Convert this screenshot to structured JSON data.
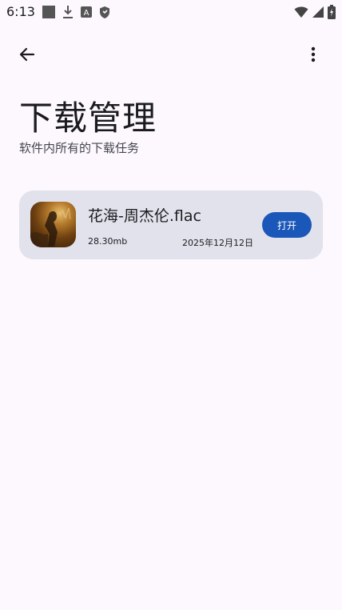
{
  "status_bar": {
    "time": "6:13",
    "left_icons": [
      "stop-square-icon",
      "download-arrow-icon",
      "font-a-icon",
      "shield-icon"
    ],
    "right_icons": [
      "wifi-icon",
      "signal-icon",
      "battery-charging-icon"
    ]
  },
  "app_bar": {
    "back_icon": "arrow-left-icon",
    "more_icon": "more-vert-icon"
  },
  "page": {
    "title": "下载管理",
    "subtitle": "软件内所有的下载任务"
  },
  "downloads": [
    {
      "name": "花海-周杰伦.flac",
      "size": "28.30mb",
      "date": "2025年12月12日",
      "action_label": "打开",
      "thumbnail": "album-art-thumbnail"
    }
  ],
  "colors": {
    "background": "#fcf8fd",
    "card": "#e2e2ec",
    "accent": "#1a57b8",
    "text": "#1b1b1f"
  }
}
